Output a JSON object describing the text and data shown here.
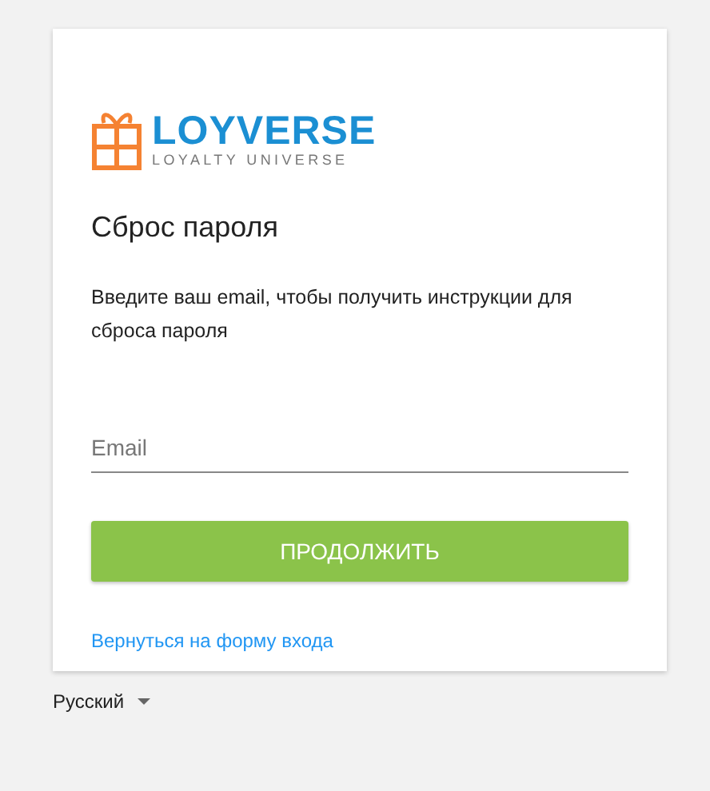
{
  "logo": {
    "name": "LOYVERSE",
    "tagline": "LOYALTY UNIVERSE"
  },
  "title": "Сброс пароля",
  "description": "Введите ваш email, чтобы получить инструкции для сброса пароля",
  "email_field": {
    "placeholder": "Email"
  },
  "submit_button": "ПРОДОЛЖИТЬ",
  "back_link": "Вернуться на форму входа",
  "language": {
    "label": "Русский"
  }
}
